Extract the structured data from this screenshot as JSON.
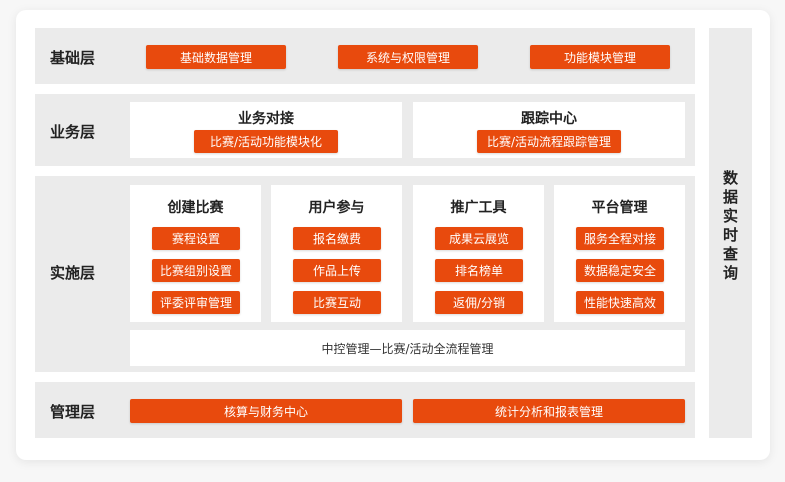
{
  "layers": {
    "base": {
      "label": "基础层",
      "items": [
        "基础数据管理",
        "系统与权限管理",
        "功能模块管理"
      ]
    },
    "business": {
      "label": "业务层",
      "boxes": [
        {
          "title": "业务对接",
          "item": "比赛/活动功能模块化"
        },
        {
          "title": "跟踪中心",
          "item": "比赛/活动流程跟踪管理"
        }
      ]
    },
    "implementation": {
      "label": "实施层",
      "columns": [
        {
          "title": "创建比赛",
          "items": [
            "赛程设置",
            "比赛组别设置",
            "评委评审管理"
          ]
        },
        {
          "title": "用户参与",
          "items": [
            "报名缴费",
            "作品上传",
            "比赛互动"
          ]
        },
        {
          "title": "推广工具",
          "items": [
            "成果云展览",
            "排名榜单",
            "返佣/分销"
          ]
        },
        {
          "title": "平台管理",
          "items": [
            "服务全程对接",
            "数据稳定安全",
            "性能快速高效"
          ]
        }
      ],
      "control": "中控管理—比赛/活动全流程管理"
    },
    "management": {
      "label": "管理层",
      "items": [
        "核算与财务中心",
        "统计分析和报表管理"
      ]
    }
  },
  "side_panel": "数据实时查询",
  "colors": {
    "accent": "#e84a0d",
    "band": "#ebebeb",
    "card": "#ffffff"
  }
}
